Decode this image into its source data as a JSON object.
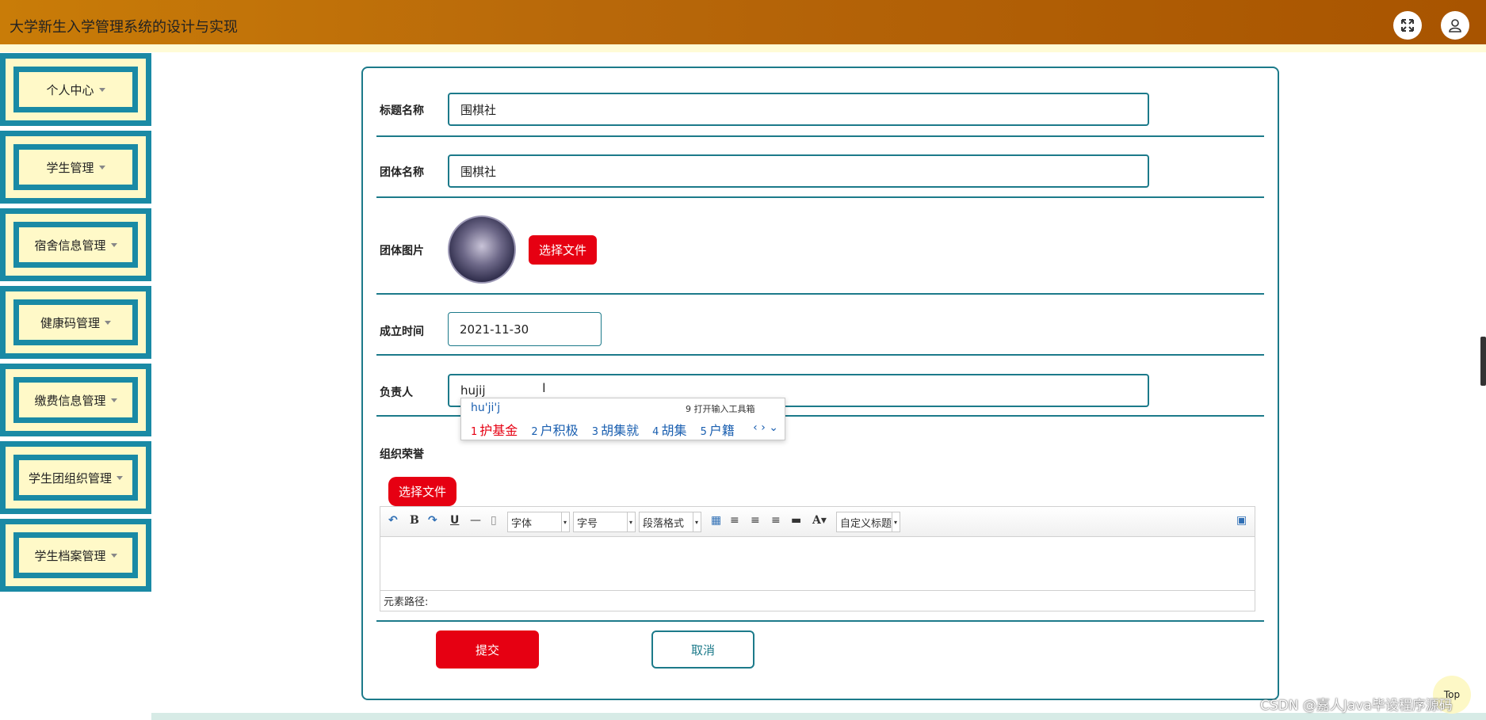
{
  "app": {
    "title": "大学新生入学管理系统的设计与实现",
    "icons": {
      "fullscreen": "expand-icon",
      "user": "user-icon"
    }
  },
  "sidebar": {
    "items": [
      {
        "label": "个人中心"
      },
      {
        "label": "学生管理"
      },
      {
        "label": "宿舍信息管理"
      },
      {
        "label": "健康码管理"
      },
      {
        "label": "缴费信息管理"
      },
      {
        "label": "学生团组织管理"
      },
      {
        "label": "学生档案管理"
      }
    ]
  },
  "form": {
    "title_label": "标题名称",
    "title_value": "围棋社",
    "group_label": "团体名称",
    "group_value": "围棋社",
    "image_label": "团体图片",
    "image_button": "选择文件",
    "date_label": "成立时间",
    "date_value": "2021-11-30",
    "leader_label": "负责人",
    "leader_value": "hujij",
    "honor_label": "组织荣誉",
    "honor_button": "选择文件",
    "submit": "提交",
    "cancel": "取消"
  },
  "ime": {
    "pinyin": "hu'ji'j",
    "tool_text": "9 打开输入工具箱",
    "candidates": [
      {
        "num": "1",
        "text": "护基金"
      },
      {
        "num": "2",
        "text": "户积极"
      },
      {
        "num": "3",
        "text": "胡集就"
      },
      {
        "num": "4",
        "text": "胡集"
      },
      {
        "num": "5",
        "text": "户籍"
      }
    ]
  },
  "editor": {
    "font": "字体",
    "size": "字号",
    "paragraph": "段落格式",
    "custom_title": "自定义标题",
    "path_label": "元素路径:"
  },
  "footer": {
    "watermark": "CSDN @嘉人Java毕设程序源码",
    "top": "Top"
  },
  "colors": {
    "accent": "#1c7a8a",
    "primary_button": "#e60012",
    "header": "#b8680a",
    "sidebar_bg": "#fff9c8"
  }
}
